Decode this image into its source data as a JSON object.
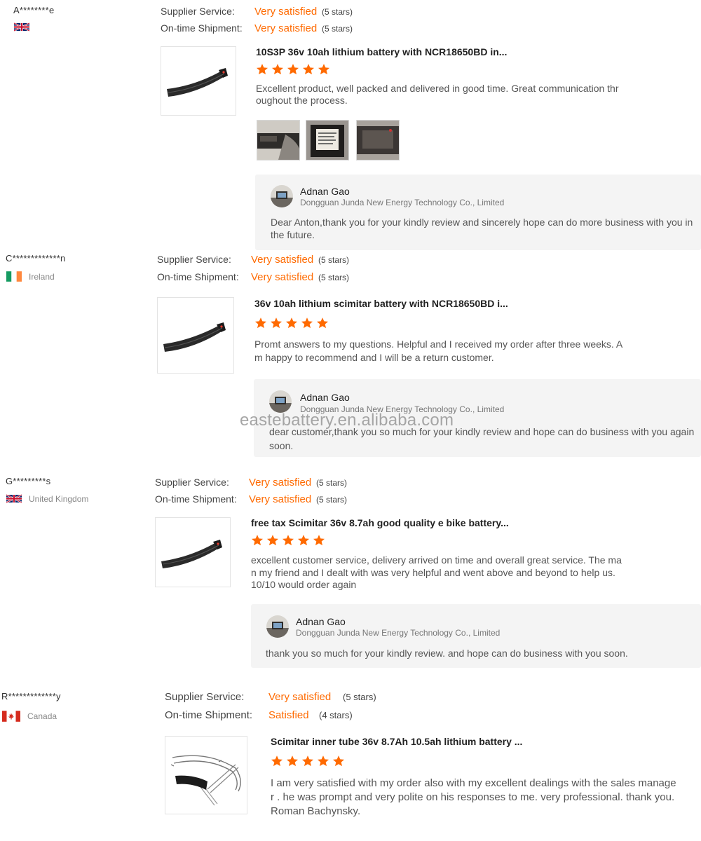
{
  "labels": {
    "supplier_service": "Supplier Service:",
    "on_time_shipment": "On-time Shipment:"
  },
  "colors": {
    "accent": "#ff6a00",
    "reply_bg": "#f4f4f4"
  },
  "watermark": "eastebattery.en.alibaba.com",
  "reviews": [
    {
      "buyer": "A********e",
      "country": "",
      "flag": "uk-flag-icon",
      "supplier_service": {
        "value": "Very satisfied",
        "count": "(5 stars)"
      },
      "on_time_shipment": {
        "value": "Very satisfied",
        "count": "(5 stars)"
      },
      "product_title": "10S3P 36v 10ah lithium battery with NCR18650BD in...",
      "stars": 5,
      "text": "Excellent product, well packed and delivered in good time. Great communication throughout the process.",
      "photos": [
        "battery-photo-1",
        "battery-photo-2",
        "battery-photo-3"
      ],
      "reply": {
        "name": "Adnan Gao",
        "company": "Dongguan Junda New Energy Technology Co., Limited",
        "message": "Dear Anton,thank you for your kindly review and sincerely hope can do more business with you in the future."
      }
    },
    {
      "buyer": "C*************n",
      "country": "Ireland",
      "flag": "ireland-flag-icon",
      "supplier_service": {
        "value": "Very satisfied",
        "count": "(5 stars)"
      },
      "on_time_shipment": {
        "value": "Very satisfied",
        "count": "(5 stars)"
      },
      "product_title": "36v 10ah lithium scimitar battery with NCR18650BD i...",
      "stars": 5,
      "text": "Promt answers to my questions.   Helpful and I received my order after three weeks.   Am happy to recommend and I will be a return customer.",
      "reply": {
        "name": "Adnan Gao",
        "company": "Dongguan Junda New Energy Technology Co., Limited",
        "message": "dear customer,thank you so much for your kindly review and hope can do business with you again soon."
      }
    },
    {
      "buyer": "G*********s",
      "country": "United Kingdom",
      "flag": "uk-flag-icon",
      "supplier_service": {
        "value": "Very satisfied",
        "count": "(5 stars)"
      },
      "on_time_shipment": {
        "value": "Very satisfied",
        "count": "(5 stars)"
      },
      "product_title": "free tax Scimitar 36v 8.7ah good quality e bike battery...",
      "stars": 5,
      "text": "excellent customer service, delivery arrived on time and overall great service. The man my friend and I dealt with was very helpful and went above and beyond to help us. 10/10 would order again",
      "reply": {
        "name": "Adnan Gao",
        "company": "Dongguan Junda New Energy Technology Co., Limited",
        "message": "thank you so much for your kindly review. and hope can do business with you soon."
      }
    },
    {
      "buyer": "R*************y",
      "country": "Canada",
      "flag": "canada-flag-icon",
      "supplier_service": {
        "value": "Very satisfied",
        "count": "(5 stars)"
      },
      "on_time_shipment": {
        "value": "Satisfied",
        "count": "(4 stars)"
      },
      "product_title": "Scimitar inner tube 36v 8.7Ah 10.5ah lithium battery ...",
      "stars": 5,
      "text": "I am very satisfied with my order also with my excellent dealings with the sales manager . he was prompt and very polite on his responses to me. very professional. thank you.Roman Bachynsky."
    }
  ]
}
